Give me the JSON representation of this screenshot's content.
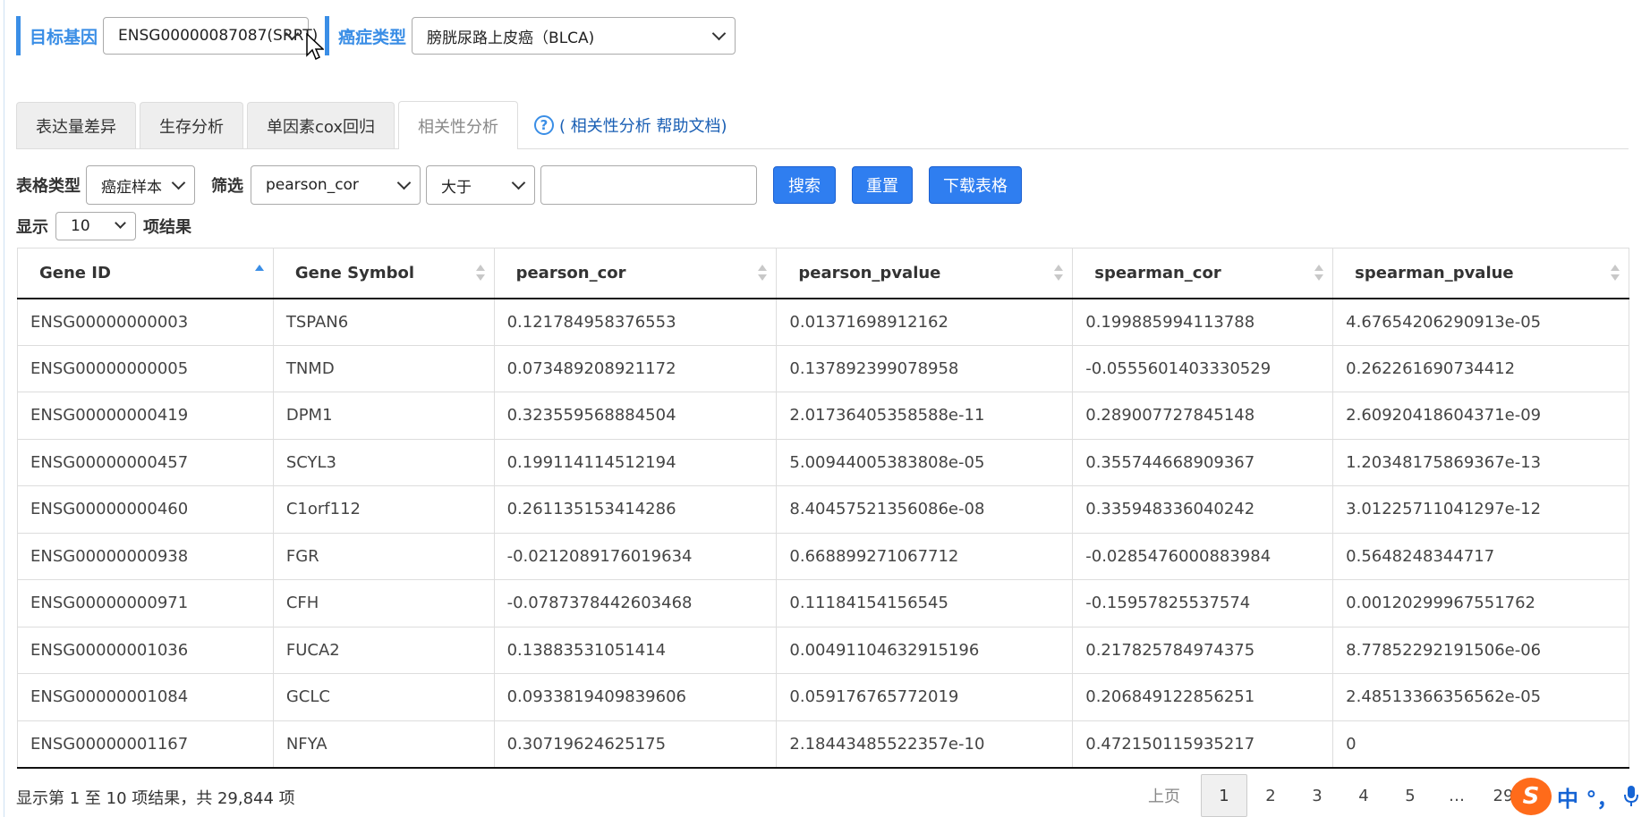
{
  "header": {
    "target_gene_label": "目标基因",
    "target_gene_value": "ENSG00000087087(SRRT)",
    "cancer_type_label": "癌症类型",
    "cancer_type_value": "膀胱尿路上皮癌（BLCA)"
  },
  "tabs": [
    {
      "label": "表达量差异",
      "active": false
    },
    {
      "label": "生存分析",
      "active": false
    },
    {
      "label": "单因素cox回归",
      "active": false
    },
    {
      "label": "相关性分析",
      "active": true
    }
  ],
  "help_link": "( 相关性分析 帮助文档)",
  "filters": {
    "table_type_label": "表格类型",
    "table_type_value": "癌症样本",
    "filter_label": "筛选",
    "filter_field_value": "pearson_cor",
    "filter_op_value": "大于",
    "filter_value": "",
    "search_button": "搜索",
    "reset_button": "重置",
    "download_button": "下载表格"
  },
  "length": {
    "show_label": "显示",
    "value": "10",
    "suffix": "项结果"
  },
  "table": {
    "columns": [
      "Gene ID",
      "Gene Symbol",
      "pearson_cor",
      "pearson_pvalue",
      "spearman_cor",
      "spearman_pvalue"
    ],
    "rows": [
      [
        "ENSG00000000003",
        "TSPAN6",
        "0.121784958376553",
        "0.01371698912162",
        "0.199885994113788",
        "4.67654206290913e-05"
      ],
      [
        "ENSG00000000005",
        "TNMD",
        "0.073489208921172",
        "0.137892399078958",
        "-0.0555601403330529",
        "0.262261690734412"
      ],
      [
        "ENSG00000000419",
        "DPM1",
        "0.323559568884504",
        "2.01736405358588e-11",
        "0.289007727845148",
        "2.60920418604371e-09"
      ],
      [
        "ENSG00000000457",
        "SCYL3",
        "0.199114114512194",
        "5.00944005383808e-05",
        "0.355744668909367",
        "1.20348175869367e-13"
      ],
      [
        "ENSG00000000460",
        "C1orf112",
        "0.261135153414286",
        "8.40457521356086e-08",
        "0.335948336040242",
        "3.01225711041297e-12"
      ],
      [
        "ENSG00000000938",
        "FGR",
        "-0.0212089176019634",
        "0.668899271067712",
        "-0.0285476000883984",
        "0.5648248344717"
      ],
      [
        "ENSG00000000971",
        "CFH",
        "-0.0787378442603468",
        "0.11184154156545",
        "-0.15957825537574",
        "0.00120299967551762"
      ],
      [
        "ENSG00000001036",
        "FUCA2",
        "0.13883531051414",
        "0.00491104632915196",
        "0.217825784974375",
        "8.77852292191506e-06"
      ],
      [
        "ENSG00000001084",
        "GCLC",
        "0.0933819409839606",
        "0.059176765772019",
        "0.206849122856251",
        "2.48513366356562e-05"
      ],
      [
        "ENSG00000001167",
        "NFYA",
        "0.30719624625175",
        "2.18443485522357e-10",
        "0.472150115935217",
        "0"
      ]
    ]
  },
  "footer": {
    "info": "显示第 1 至 10 项结果，共 29,844 项",
    "prev": "上页",
    "pages": [
      "1",
      "2",
      "3",
      "4",
      "5",
      "…",
      "29"
    ],
    "current_page": "1"
  },
  "ime": {
    "logo": "S",
    "text": "中 °，"
  },
  "colors": {
    "accent": "#3a8ee6",
    "button": "#2f7ef0",
    "link": "#1a5fb4"
  }
}
